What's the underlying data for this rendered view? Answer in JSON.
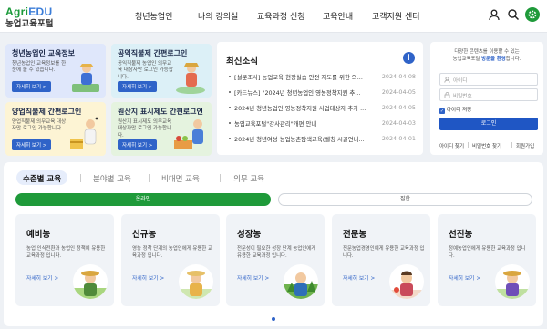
{
  "header": {
    "logo_en_a": "Agri",
    "logo_en_b": "EDU",
    "logo_ko": "농업교육포털",
    "nav": [
      "청년농업인",
      "나의 강의실",
      "교육과정 신청",
      "교육안내",
      "고객지원 센터"
    ]
  },
  "cards": [
    {
      "title": "청년농업인 교육정보",
      "desc": "청년농업인 교육정보를 한 눈에 볼 수 있습니다.",
      "btn": "자세히 보기 >",
      "bg": "#dfe7fb"
    },
    {
      "title": "공익직불제 간편로그인",
      "desc": "공익직불제 농업인 의무교육 대상자만 로그인 가능합니다.",
      "btn": "자세히 보기 >",
      "bg": "#dcf0f7"
    },
    {
      "title": "양업직불제 간편로그인",
      "desc": "양업직불제 의무교육 대상자만 로그인 가능합니다.",
      "btn": "자세히 보기 >",
      "bg": "#fdf4d4"
    },
    {
      "title": "원산지 표시제도 간편로그인",
      "desc": "원산지 표시제도 의무교육 대상자만 로그인 가능합니다.",
      "btn": "자세히 보기 >",
      "bg": "#e5f3df"
    }
  ],
  "notice": {
    "title": "최신소식",
    "items": [
      {
        "title": "[설문조사] 농업교육 현장실습 안전 지도를 위한 의...",
        "date": "2024-04-08"
      },
      {
        "title": "[카드뉴스] \"2024년 청년농업인 영농정착지원 추...",
        "date": "2024-04-05"
      },
      {
        "title": "2024년 청년농업인 영농정착지원 사업대상자 추가 ...",
        "date": "2024-04-05"
      },
      {
        "title": "농업교육포털\"강사관리\"개편 안내",
        "date": "2024-04-03"
      },
      {
        "title": "2024년 청년여성 농업농촌탐색교육(벨칭 시골언니...",
        "date": "2024-04-01"
      }
    ]
  },
  "login": {
    "intro_a": "다양한 콘텐츠를 이용할 수 있는",
    "intro_b": "농업교육포털",
    "intro_c": "방문을 환영",
    "intro_d": "합니다.",
    "id_placeholder": "아이디",
    "pw_placeholder": "비밀번호",
    "save_label": "아이디 저장",
    "login_btn": "로그인",
    "links": [
      "아이디 찾기",
      "비밀번호 찾기",
      "회원가입"
    ]
  },
  "tabs": [
    "수준별 교육",
    "분야별 교육",
    "비대면 교육",
    "의무 교육"
  ],
  "toggle": {
    "on": "온라인",
    "off": "집합"
  },
  "courses": [
    {
      "title": "예비농",
      "desc": "농업 인식전환과 농업인 정책에 유용한 교육과정 입니다.",
      "more": "자세히 보기 >"
    },
    {
      "title": "신규농",
      "desc": "영농 정착 단계의 농업인에게 유용한 교육과정 입니다.",
      "more": "자세히 보기 >"
    },
    {
      "title": "성장농",
      "desc": "전문성이 필요한 성장 단계 농업인에게 유용한 교육과정 입니다.",
      "more": "자세히 보기 >"
    },
    {
      "title": "전문농",
      "desc": "전문농업경영인에게 유용한 교육과정 입니다.",
      "more": "자세히 보기 >"
    },
    {
      "title": "선진농",
      "desc": "정예농업인에게 유용한 교육과정 입니다.",
      "more": "자세히 보기 >"
    }
  ],
  "colors": {
    "brand_green": "#1b9a3a",
    "brand_blue": "#2f63c8",
    "toggle_active": "#1f9a3a"
  },
  "icons": [
    "user-icon",
    "search-icon",
    "settings-icon",
    "plus-icon",
    "id-icon",
    "lock-icon",
    "checkbox-icon"
  ]
}
